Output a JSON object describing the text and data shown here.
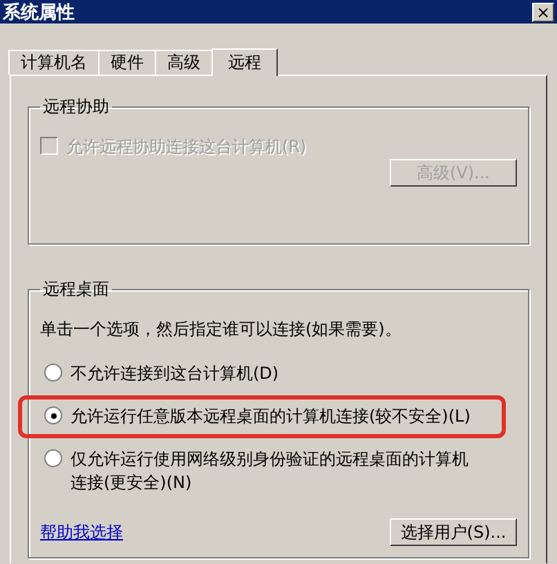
{
  "window": {
    "title": "系统属性",
    "close": "×"
  },
  "tabs": [
    {
      "label": "计算机名",
      "selected": false
    },
    {
      "label": "硬件",
      "selected": false
    },
    {
      "label": "高级",
      "selected": false
    },
    {
      "label": "远程",
      "selected": true
    }
  ],
  "remote_assistance": {
    "title": "远程协助",
    "checkbox": {
      "label": "允许远程协助连接这台计算机(R)",
      "checked": false,
      "disabled": true
    },
    "button": {
      "label": "高级(V)...",
      "disabled": true
    }
  },
  "remote_desktop": {
    "title": "远程桌面",
    "instruction": "单击一个选项，然后指定谁可以连接(如果需要)。",
    "options": [
      {
        "label": "不允许连接到这台计算机(D)",
        "selected": false,
        "highlighted": false
      },
      {
        "label": "允许运行任意版本远程桌面的计算机连接(较不安全)(L)",
        "selected": true,
        "highlighted": true
      },
      {
        "label": "仅允许运行使用网络级别身份验证的远程桌面的计算机连接(更安全)(N)",
        "selected": false,
        "highlighted": false
      }
    ],
    "help_link": "帮助我选择",
    "button": {
      "label": "选择用户(S)..."
    }
  }
}
